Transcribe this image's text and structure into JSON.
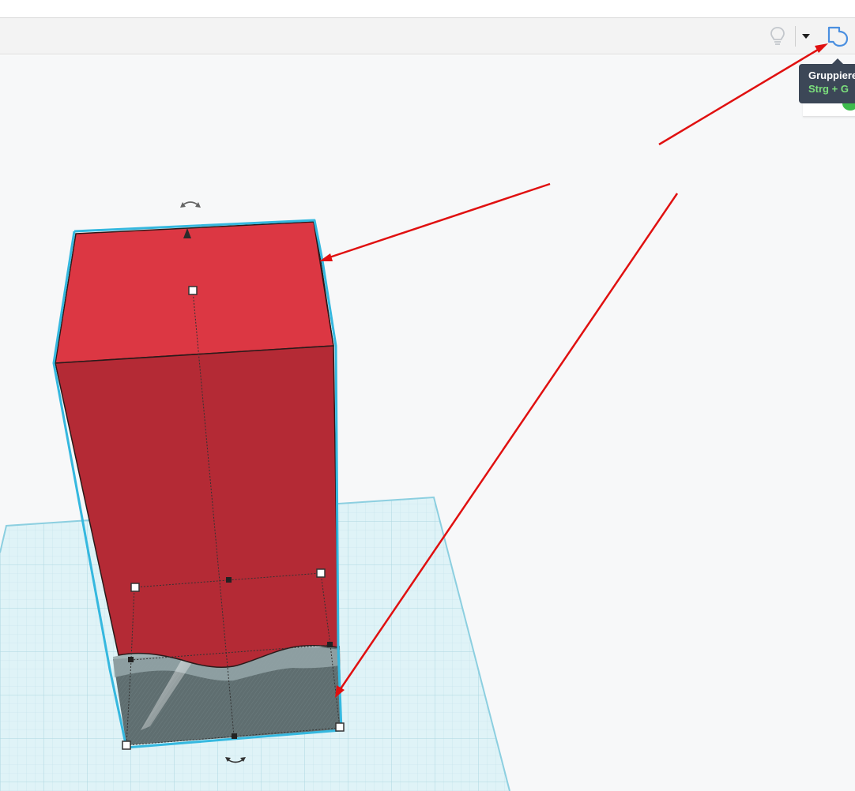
{
  "toolbar": {
    "icons": [
      "lightbulb-icon",
      "caret-down-icon",
      "group-shape-icon"
    ],
    "accent_color": "#4a8fe0"
  },
  "tooltip": {
    "title": "Gruppiere",
    "shortcut": "Strg + G",
    "shortcut_color": "#7ce07c"
  },
  "scene": {
    "box_top_color": "#dc3743",
    "box_side_color": "#b42a35",
    "hole_color": "#5f6e70",
    "selection_outline_color": "#35b8df",
    "workplane_color": "#dff3f7",
    "annotation_arrow_color": "#e01010"
  }
}
